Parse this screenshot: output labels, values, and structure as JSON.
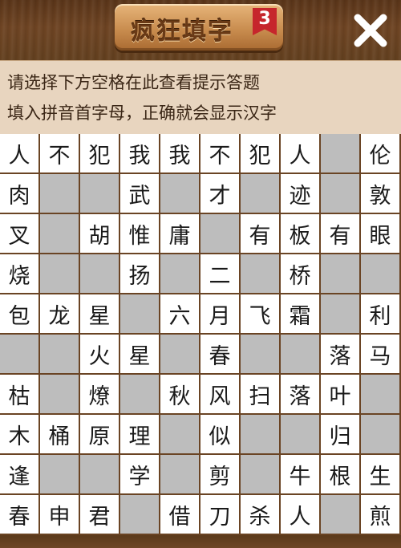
{
  "header": {
    "title": "疯狂填字",
    "level": "3",
    "colors": {
      "wood": "#6b4321",
      "plaque": "#c98d4f",
      "badge": "#c6262c"
    }
  },
  "close_icon": "close-icon",
  "hint": {
    "line1": "请选择下方空格在此查看提示答题",
    "line2": "填入拼音首字母，正确就会显示汉字"
  },
  "board": {
    "rows": [
      [
        "人",
        "不",
        "犯",
        "我",
        "我",
        "不",
        "犯",
        "人",
        "",
        "伦"
      ],
      [
        "肉",
        "",
        "",
        "武",
        "",
        "才",
        "",
        "迹",
        "",
        "敦"
      ],
      [
        "叉",
        "",
        "胡",
        "惟",
        "庸",
        "",
        "有",
        "板",
        "有",
        "眼"
      ],
      [
        "烧",
        "",
        "",
        "扬",
        "",
        "二",
        "",
        "桥",
        "",
        ""
      ],
      [
        "包",
        "龙",
        "星",
        "",
        "六",
        "月",
        "飞",
        "霜",
        "",
        "利"
      ],
      [
        "",
        "",
        "火",
        "星",
        "",
        "春",
        "",
        "",
        "落",
        "马"
      ],
      [
        "枯",
        "",
        "燎",
        "",
        "秋",
        "风",
        "扫",
        "落",
        "叶",
        ""
      ],
      [
        "木",
        "桶",
        "原",
        "理",
        "",
        "似",
        "",
        "",
        "归",
        ""
      ],
      [
        "逢",
        "",
        "",
        "学",
        "",
        "剪",
        "",
        "牛",
        "根",
        "生"
      ],
      [
        "春",
        "申",
        "君",
        "",
        "借",
        "刀",
        "杀",
        "人",
        "",
        "煎"
      ]
    ]
  }
}
